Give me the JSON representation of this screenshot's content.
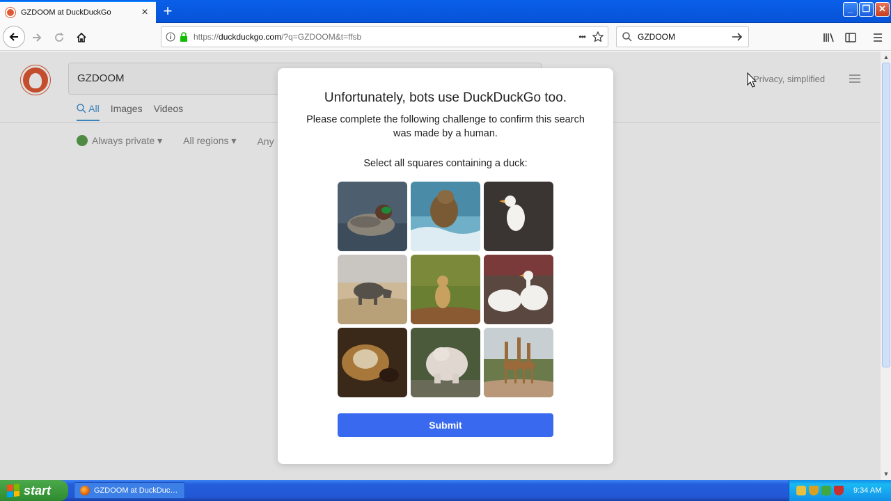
{
  "browser": {
    "tab_title": "GZDOOM at DuckDuckGo",
    "new_tab_symbol": "+",
    "url_prefix": "https://",
    "url_domain": "duckduckgo.com",
    "url_path": "/?q=GZDOOM&t=ffsb",
    "url_more": "•••",
    "search_value": "GZDOOM",
    "window_buttons": [
      "_",
      "❐",
      "✕"
    ]
  },
  "page": {
    "search_value": "GZDOOM",
    "tabs": [
      "All",
      "Images",
      "Videos"
    ],
    "filters": [
      "Always private ▾",
      "All regions ▾",
      "Any"
    ],
    "tagline": "Privacy, simplified"
  },
  "modal": {
    "title": "Unfortunately, bots use DuckDuckGo too.",
    "subtitle": "Please complete the following challenge to confirm this search was made by a human.",
    "instruction": "Select all squares containing a duck:",
    "tiles": [
      "duck (teal)",
      "bear in water",
      "white duck",
      "rhino",
      "lion",
      "white ducks",
      "dog",
      "polar bear",
      "giraffes"
    ],
    "submit_label": "Submit"
  },
  "taskbar": {
    "start_label": "start",
    "task_title": "GZDOOM at DuckDuc…",
    "clock": "9:34 AM"
  },
  "colors": {
    "accent": "#3969ef",
    "ddg_orange": "#de5833",
    "xp_blue": "#245edb",
    "xp_green": "#3c9a3c"
  }
}
